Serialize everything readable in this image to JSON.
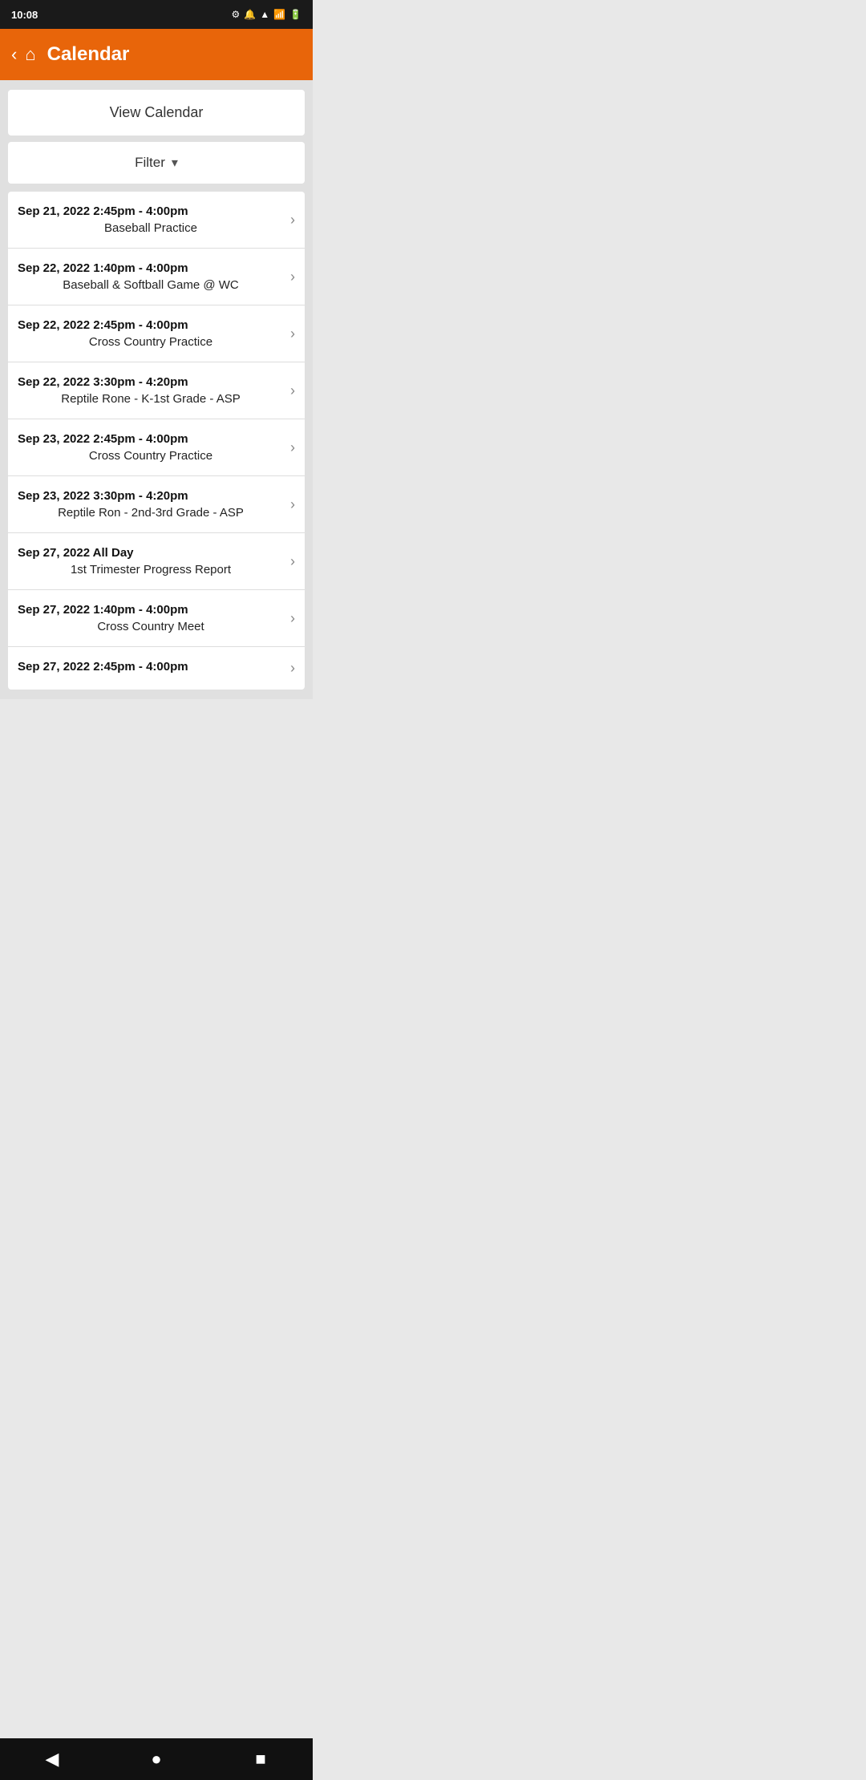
{
  "statusBar": {
    "time": "10:08",
    "icons": [
      "settings",
      "notification",
      "wifi",
      "signal",
      "battery"
    ]
  },
  "header": {
    "back_label": "‹",
    "home_label": "⌂",
    "title": "Calendar"
  },
  "viewCalendarButton": {
    "label": "View Calendar"
  },
  "filter": {
    "label": "Filter",
    "chevron": "▾"
  },
  "events": [
    {
      "date": "Sep 21, 2022",
      "time": "2:45pm - 4:00pm",
      "title": "Baseball Practice"
    },
    {
      "date": "Sep 22, 2022",
      "time": "1:40pm - 4:00pm",
      "title": "Baseball & Softball Game @ WC"
    },
    {
      "date": "Sep 22, 2022",
      "time": "2:45pm - 4:00pm",
      "title": "Cross Country Practice"
    },
    {
      "date": "Sep 22, 2022",
      "time": "3:30pm - 4:20pm",
      "title": "Reptile Rone - K-1st Grade - ASP"
    },
    {
      "date": "Sep 23, 2022",
      "time": "2:45pm - 4:00pm",
      "title": "Cross Country Practice"
    },
    {
      "date": "Sep 23, 2022",
      "time": "3:30pm - 4:20pm",
      "title": "Reptile Ron - 2nd-3rd Grade - ASP"
    },
    {
      "date": "Sep 27, 2022",
      "time": "All Day",
      "title": "1st Trimester Progress Report"
    },
    {
      "date": "Sep 27, 2022",
      "time": "1:40pm - 4:00pm",
      "title": "Cross Country Meet"
    },
    {
      "date": "Sep 27, 2022",
      "time": "2:45pm - 4:00pm",
      "title": ""
    }
  ],
  "navBar": {
    "back": "◀",
    "home_circle": "●",
    "square": "■"
  }
}
